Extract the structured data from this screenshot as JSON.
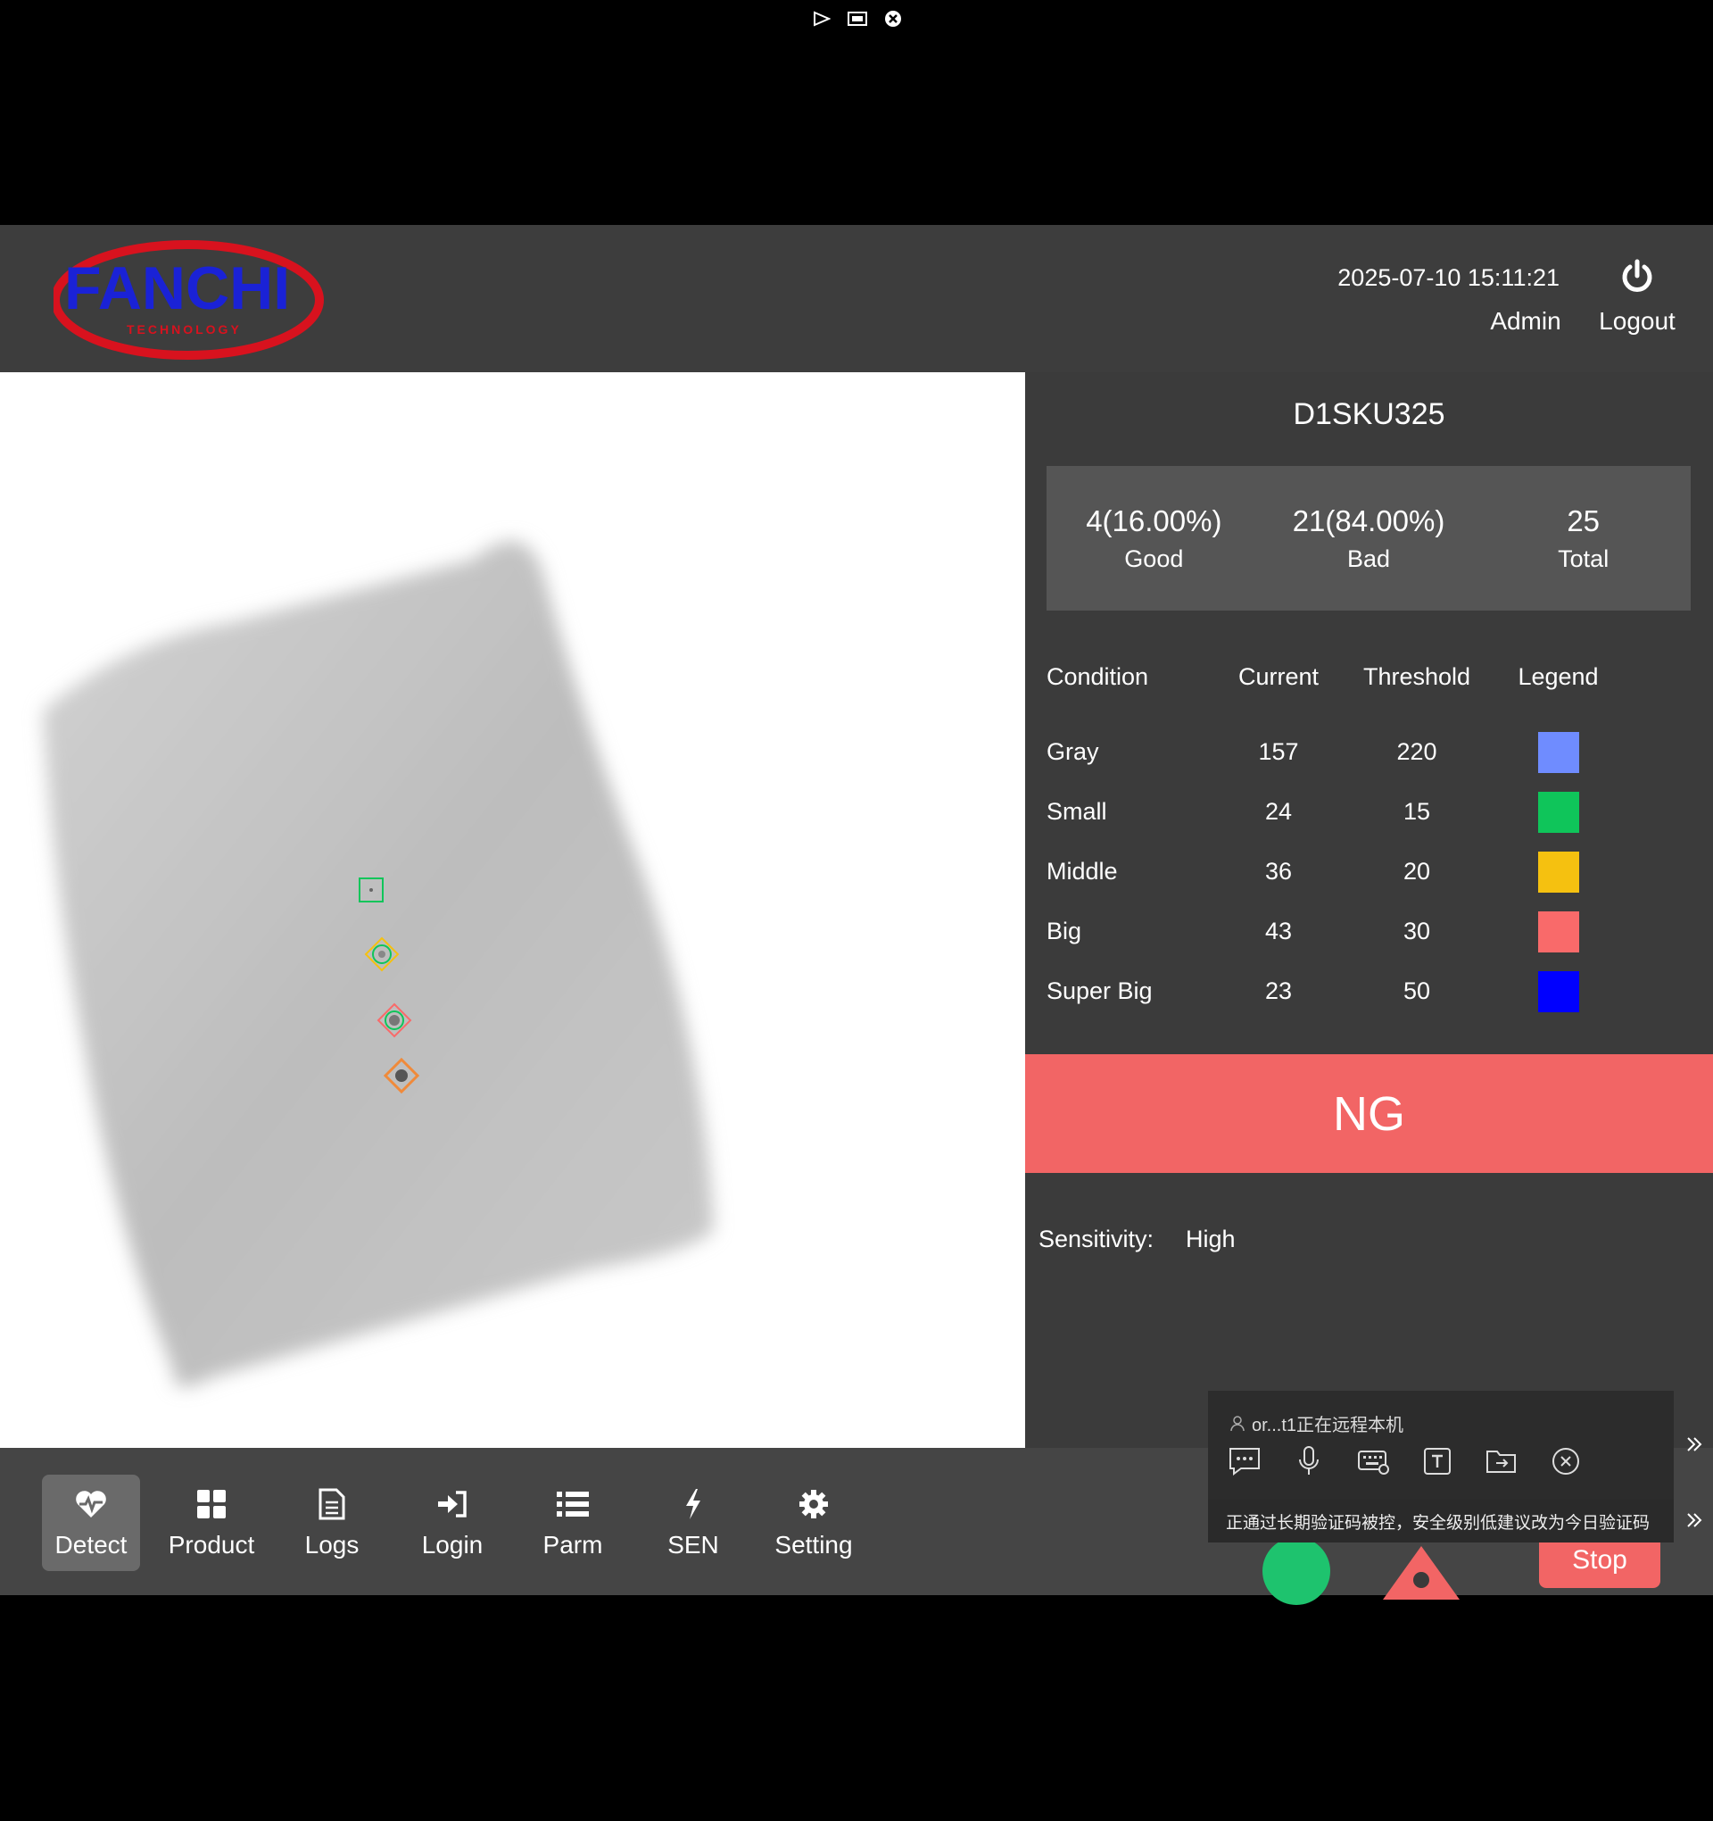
{
  "header": {
    "logo_text": "FANCHI",
    "logo_subtext": "TECHNOLOGY",
    "datetime": "2025-07-10 15:11:21",
    "user": "Admin",
    "logout_label": "Logout"
  },
  "panel": {
    "product_name": "D1SKU325",
    "stats": {
      "good_value": "4(16.00%)",
      "good_label": "Good",
      "bad_value": "21(84.00%)",
      "bad_label": "Bad",
      "total_value": "25",
      "total_label": "Total"
    },
    "table": {
      "headers": [
        "Condition",
        "Current",
        "Threshold",
        "Legend"
      ],
      "rows": [
        {
          "condition": "Gray",
          "current": "157",
          "threshold": "220",
          "color": "#6f8cff"
        },
        {
          "condition": "Small",
          "current": "24",
          "threshold": "15",
          "color": "#0fc55a"
        },
        {
          "condition": "Middle",
          "current": "36",
          "threshold": "20",
          "color": "#f5c110"
        },
        {
          "condition": "Big",
          "current": "43",
          "threshold": "30",
          "color": "#f96a6a"
        },
        {
          "condition": "Super Big",
          "current": "23",
          "threshold": "50",
          "color": "#0000ff"
        }
      ]
    },
    "result": "NG",
    "sensitivity_label": "Sensitivity:",
    "sensitivity_value": "High"
  },
  "toolbar": {
    "items": [
      {
        "label": "Detect",
        "icon": "heartbeat-icon",
        "active": true
      },
      {
        "label": "Product",
        "icon": "grid-icon"
      },
      {
        "label": "Logs",
        "icon": "document-icon"
      },
      {
        "label": "Login",
        "icon": "sign-in-icon"
      },
      {
        "label": "Parm",
        "icon": "list-icon"
      },
      {
        "label": "SEN",
        "icon": "bolt-icon"
      },
      {
        "label": "Setting",
        "icon": "gear-icon"
      }
    ],
    "stop_label": "Stop"
  },
  "remote": {
    "user_text": "or...t1正在远程本机",
    "notice": "正通过长期验证码被控，安全级别低建议改为今日验证码"
  },
  "colors": {
    "header_bg": "#3d3d3d",
    "panel_bg": "#3b3b3b",
    "ng_red": "#f26565",
    "ok_green": "#1ec36e"
  }
}
